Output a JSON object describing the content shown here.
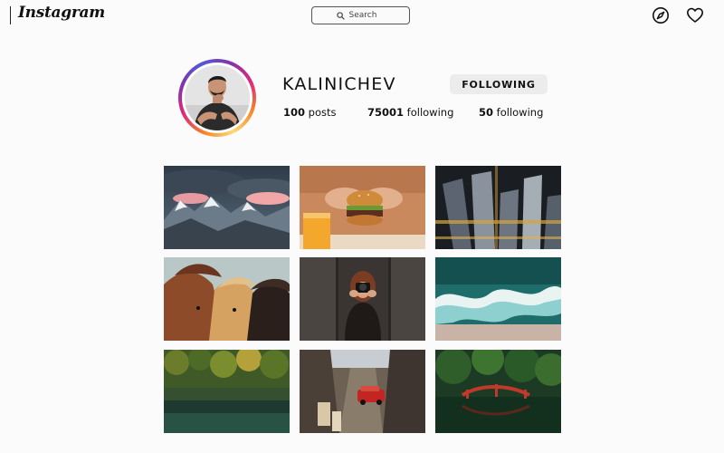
{
  "app": {
    "logo_text": "Instagram"
  },
  "search": {
    "placeholder": "Search"
  },
  "profile": {
    "username": "KALINICHEV",
    "follow_button_label": "FOLLOWING",
    "stats": {
      "posts_count": "100",
      "posts_label": "posts",
      "followers_count": "75001",
      "followers_label": "following",
      "following_count": "50",
      "following_label": "following"
    }
  },
  "nav": {
    "icons": [
      "compass-icon",
      "heart-icon"
    ]
  },
  "colors": {
    "story_ring": [
      "#f58529",
      "#dd2a7b",
      "#8134af",
      "#515bd4"
    ],
    "button_bg": "#ececec",
    "background": "#fbfbfb"
  },
  "posts": [
    {
      "subject": "snowy-mountains-pink-clouds"
    },
    {
      "subject": "burger-and-orange-juice"
    },
    {
      "subject": "city-skyscrapers-aerial"
    },
    {
      "subject": "three-horses"
    },
    {
      "subject": "woman-with-camera"
    },
    {
      "subject": "ocean-waves-aerial"
    },
    {
      "subject": "forest-lake-reflection"
    },
    {
      "subject": "city-street-red-taxi"
    },
    {
      "subject": "red-bridge-in-forest"
    }
  ]
}
